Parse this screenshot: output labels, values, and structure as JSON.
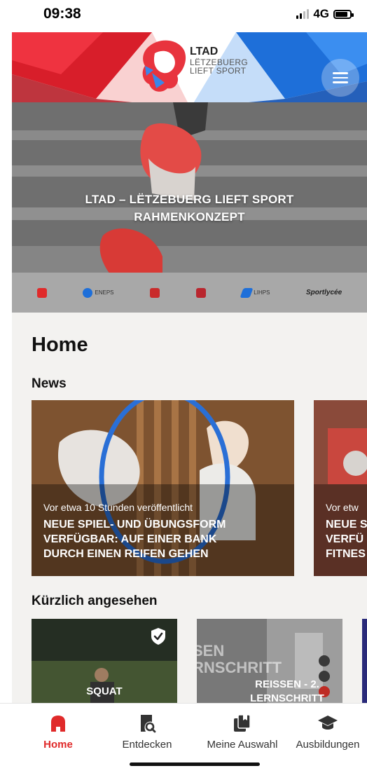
{
  "status": {
    "time": "09:38",
    "network": "4G",
    "battery_level": 0.75
  },
  "header": {
    "logo_title": "LTAD",
    "logo_line1": "LËTZEBUERG",
    "logo_line2": "LIEFT SPORT",
    "menu_icon": "hamburger-menu-icon"
  },
  "hero": {
    "title_line1": "LTAD – LËTZEBUERG LIEFT SPORT",
    "title_line2": "RAHMENKONZEPT"
  },
  "partners": [
    {
      "label": "LE GOUVERNEMENT DU GRAND-DUCHÉ DE LUXEMBOURG Ministère des Sports"
    },
    {
      "label": "ENEPS"
    },
    {
      "label": "COSL"
    },
    {
      "label": "TEAM LËTZEBUERG"
    },
    {
      "label": "LIHPS"
    },
    {
      "label": "Sportlycée"
    }
  ],
  "main": {
    "page_title": "Home",
    "news_heading": "News",
    "news": [
      {
        "meta": "Vor etwa 10 Stunden veröffentlicht",
        "title_lines": [
          "NEUE SPIEL- UND ÜBUNGSFORM",
          "VERFÜGBAR:  AUF EINER BANK",
          "DURCH EINEN REIFEN GEHEN"
        ]
      },
      {
        "meta": "Vor etw",
        "title_lines": [
          "NEUE S",
          "VERFÜ",
          "FITNES"
        ]
      }
    ],
    "recent_heading": "Kürzlich angesehen",
    "recent": [
      {
        "title_lines": [
          "SQUAT"
        ],
        "bookmarked": true
      },
      {
        "title_lines": [
          "REISSEN - 2.",
          "LERNSCHRITT"
        ],
        "bg_text_lines": [
          "SEN",
          "RNSCHRITT"
        ]
      }
    ]
  },
  "tabs": [
    {
      "label": "Home",
      "icon": "home-icon",
      "active": true
    },
    {
      "label": "Entdecken",
      "icon": "discover-book-icon",
      "active": false
    },
    {
      "label": "Meine Auswahl",
      "icon": "my-selection-icon",
      "active": false
    },
    {
      "label": "Ausbildungen",
      "icon": "graduation-cap-icon",
      "active": false
    }
  ],
  "colors": {
    "accent_red": "#e02a2a",
    "brand_blue": "#1e6fd9",
    "background": "#f3f2f0"
  }
}
